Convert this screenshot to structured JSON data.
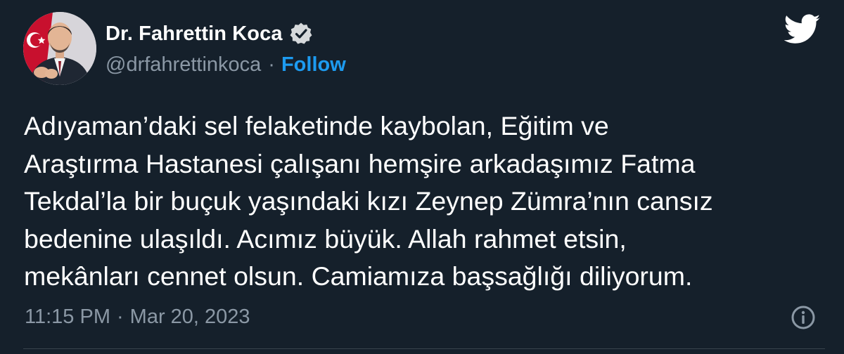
{
  "author": {
    "name": "Dr. Fahrettin Koca",
    "handle": "@drfahrettinkoca",
    "verified": true,
    "follow_label": "Follow"
  },
  "tweet": {
    "lines": [
      "Adıyaman’daki sel felaketinde kaybolan, Eğitim ve",
      "Araştırma Hastanesi çalışanı hemşire arkadaşımız Fatma",
      "Tekdal’la bir buçuk yaşındaki kızı Zeynep Zümra’nın cansız",
      "bedenine ulaşıldı. Acımız büyük. Allah rahmet etsin,",
      "mekânları cennet olsun. Camiamıza başsağlığı diliyorum."
    ],
    "time": "11:15 PM",
    "date": "Mar 20, 2023",
    "separator": "·"
  },
  "icons": {
    "brand": "twitter-bird-icon",
    "verified": "verified-badge-icon",
    "info": "info-icon"
  },
  "colors": {
    "background": "#15202b",
    "text_primary": "#ffffff",
    "text_secondary": "#8b98a5",
    "accent": "#1d9bf0"
  }
}
